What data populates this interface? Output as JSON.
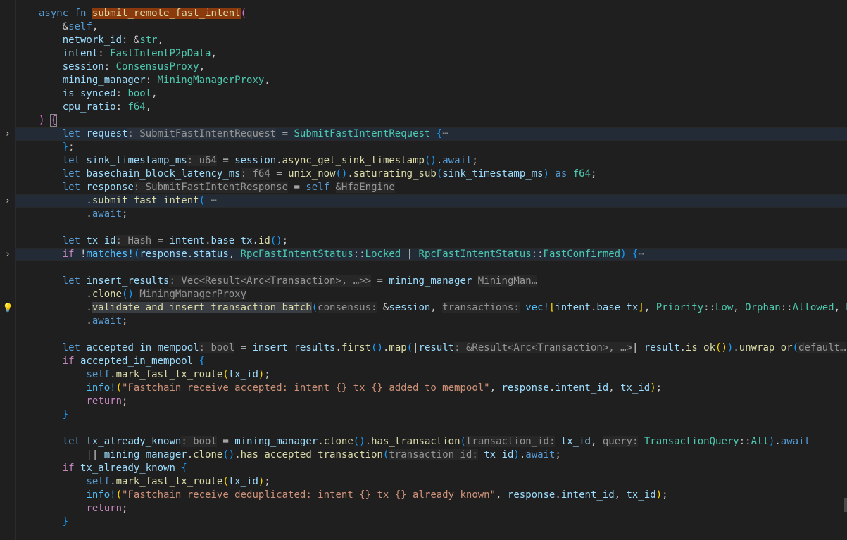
{
  "editor": {
    "language": "rust",
    "theme_colors": {
      "background": "#1f1f1f",
      "keyword": "#569cd6",
      "control": "#c586c0",
      "function": "#dcdcaa",
      "variable": "#9cdcfe",
      "type": "#4ec9b0",
      "string": "#ce9178",
      "macro": "#4fc1ff"
    },
    "gutter": {
      "fold_icon": "chevron-right-icon",
      "lightbulb_icon": "lightbulb-icon"
    },
    "text": {
      "l1_async": "async",
      "l1_fn": "fn",
      "l1_name": "submit_remote_fast_intent",
      "l2_self": "self",
      "p_network_id": "network_id",
      "t_str": "str",
      "p_intent": "intent",
      "t_FastIntentP2pData": "FastIntentP2pData",
      "p_session": "session",
      "t_ConsensusProxy": "ConsensusProxy",
      "p_mining_manager": "mining_manager",
      "t_MiningManagerProxy": "MiningManagerProxy",
      "p_is_synced": "is_synced",
      "t_bool": "bool",
      "p_cpu_ratio": "cpu_ratio",
      "t_f64": "f64",
      "kw_let": "let",
      "v_request": "request",
      "t_SubmitFastIntentRequest": "SubmitFastIntentRequest",
      "fold_dots": "⋯",
      "v_sink_timestamp_ms": "sink_timestamp_ms",
      "t_u64": "u64",
      "v_session": "session",
      "f_async_get_sink_timestamp": "async_get_sink_timestamp",
      "kw_await": "await",
      "v_basechain_block_latency_ms": "basechain_block_latency_ms",
      "f_unix_now": "unix_now",
      "f_saturating_sub": "saturating_sub",
      "kw_as": "as",
      "v_response": "response",
      "t_SubmitFastIntentResponse": "SubmitFastIntentResponse",
      "kw_self": "self",
      "hint_HfaEngine": "&HfaEngine",
      "f_submit_fast_intent": "submit_fast_intent",
      "v_tx_id": "tx_id",
      "t_Hash": "Hash",
      "v_intent": "intent",
      "v_base_tx": "base_tx",
      "f_id": "id",
      "kw_if": "if",
      "mac_matches": "matches!",
      "v_status": "status",
      "t_RpcFastIntentStatus": "RpcFastIntentStatus",
      "ty_Locked": "Locked",
      "ty_FastConfirmed": "FastConfirmed",
      "v_insert_results": "insert_results",
      "hint_insert_results_type": ": Vec<Result<Arc<Transaction>, …>>",
      "v_mining_manager": "mining_manager",
      "hint_MiningMan": "MiningMan…",
      "f_clone": "clone",
      "hint_MiningManagerProxy": "MiningManagerProxy",
      "f_validate_and_insert_transaction_batch": "validate_and_insert_transaction_batch",
      "hint_consensus": "consensus:",
      "hint_transactions": "transactions:",
      "mac_vec": "vec!",
      "ty_Priority": "Priority",
      "ty_Low": "Low",
      "ty_Orphan": "Orphan",
      "ty_Allowed": "Allowed",
      "trail_Rb": "Rb",
      "v_accepted_in_mempool": "accepted_in_mempool",
      "v_insert_results2": "insert_results",
      "f_first": "first",
      "f_map": "map",
      "v_result": "result",
      "hint_result_type": ": &Result<Arc<Transaction>, …>",
      "f_is_ok": "is_ok",
      "f_unwrap_or": "unwrap_or",
      "hint_default": "default…",
      "f_mark_fast_tx_route": "mark_fast_tx_route",
      "mac_info": "info!",
      "str_accepted": "\"Fastchain receive accepted: intent {} tx {} added to mempool\"",
      "v_intent_id": "intent_id",
      "kw_return": "return",
      "v_tx_already_known": "tx_already_known",
      "f_has_transaction": "has_transaction",
      "hint_transaction_id": "transaction_id:",
      "hint_query": "query:",
      "ty_TransactionQuery": "TransactionQuery",
      "ty_All": "All",
      "f_has_accepted_transaction": "has_accepted_transaction",
      "str_dedup": "\"Fastchain receive deduplicated: intent {} tx {} already known\""
    }
  }
}
